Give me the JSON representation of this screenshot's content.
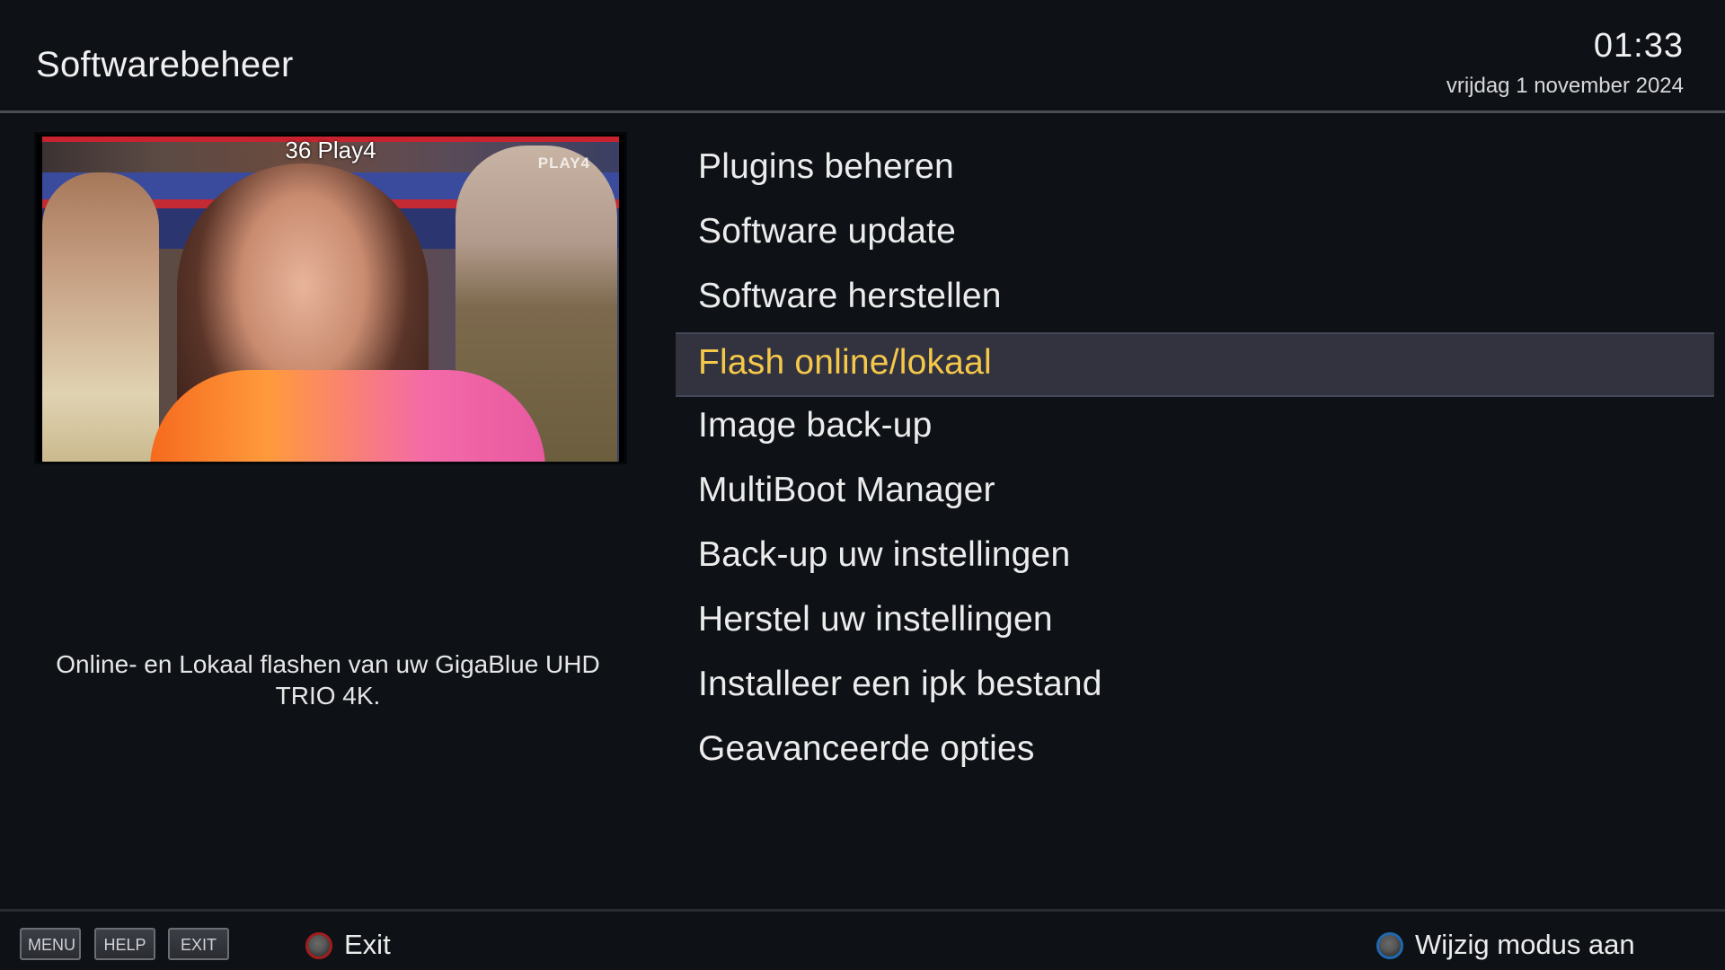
{
  "header": {
    "title": "Softwarebeheer",
    "time": "01:33",
    "date": "vrijdag 1 november 2024"
  },
  "preview": {
    "channel": "36  Play4",
    "logo_text": "PLAY4"
  },
  "description": "Online- en Lokaal flashen van uw GigaBlue UHD TRIO 4K.",
  "menu": {
    "selected_index": 3,
    "items": [
      {
        "label": "Plugins beheren"
      },
      {
        "label": "Software update"
      },
      {
        "label": "Software herstellen"
      },
      {
        "label": "Flash online/lokaal"
      },
      {
        "label": "Image back-up"
      },
      {
        "label": "MultiBoot Manager"
      },
      {
        "label": "Back-up uw instellingen"
      },
      {
        "label": "Herstel uw instellingen"
      },
      {
        "label": "Installeer een ipk bestand"
      },
      {
        "label": "Geavanceerde opties"
      }
    ]
  },
  "footer": {
    "keys": {
      "menu": "MENU",
      "help": "HELP",
      "exit": "EXIT"
    },
    "red_action": "Exit",
    "blue_action": "Wijzig modus aan"
  },
  "colors": {
    "highlight_text": "#f5c84a",
    "highlight_bg": "#32333f",
    "red_key": "#a21d1d",
    "blue_key": "#1f69b0"
  }
}
